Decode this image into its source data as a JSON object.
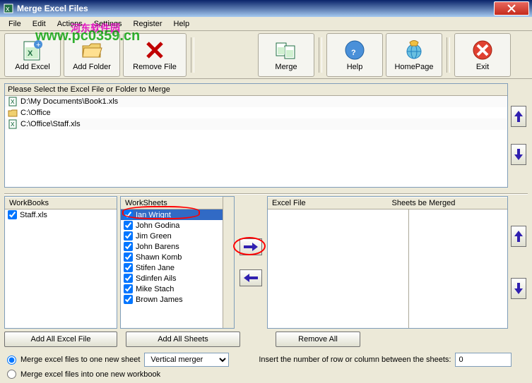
{
  "window": {
    "title": "Merge Excel Files"
  },
  "menu": {
    "file": "File",
    "edit": "Edit",
    "actions": "Actions",
    "settings": "Settings",
    "register": "Register",
    "help": "Help"
  },
  "watermark": {
    "url": "www.pc0359.cn",
    "cn": "河东软件园"
  },
  "toolbar": {
    "add_excel": "Add Excel",
    "add_folder": "Add Folder",
    "remove_file": "Remove File",
    "merge": "Merge",
    "help": "Help",
    "homepage": "HomePage",
    "exit": "Exit"
  },
  "file_panel": {
    "header": "Please Select the Excel File or Folder to Merge",
    "items": [
      {
        "icon": "xls",
        "path": "D:\\My Documents\\Book1.xls"
      },
      {
        "icon": "folder",
        "path": "C:\\Office"
      },
      {
        "icon": "xls",
        "path": "C:\\Office\\Staff.xls"
      }
    ]
  },
  "workbooks": {
    "header": "WorkBooks",
    "items": [
      {
        "checked": true,
        "name": "Staff.xls"
      }
    ]
  },
  "worksheets": {
    "header": "WorkSheets",
    "items": [
      {
        "checked": true,
        "name": "Ian Wrignt",
        "selected": true
      },
      {
        "checked": true,
        "name": "John Godina"
      },
      {
        "checked": true,
        "name": "Jim Green"
      },
      {
        "checked": true,
        "name": "John Barens"
      },
      {
        "checked": true,
        "name": "Shawn Komb"
      },
      {
        "checked": true,
        "name": "Stifen Jane"
      },
      {
        "checked": true,
        "name": "Sdinfen Ails"
      },
      {
        "checked": true,
        "name": "Mike Stach"
      },
      {
        "checked": true,
        "name": "Brown James"
      }
    ]
  },
  "merge_panel": {
    "excel_file": "Excel File",
    "sheets_merged": "Sheets be Merged"
  },
  "buttons": {
    "add_all_excel": "Add All Excel File",
    "add_all_sheets": "Add All Sheets",
    "remove_all": "Remove All"
  },
  "options": {
    "opt1": "Merge excel files to one new sheet",
    "opt2": "Merge excel files into one new workbook",
    "merger_type": "Vertical merger",
    "insert_label": "Insert the number of row or column between the sheets:",
    "insert_value": "0"
  }
}
